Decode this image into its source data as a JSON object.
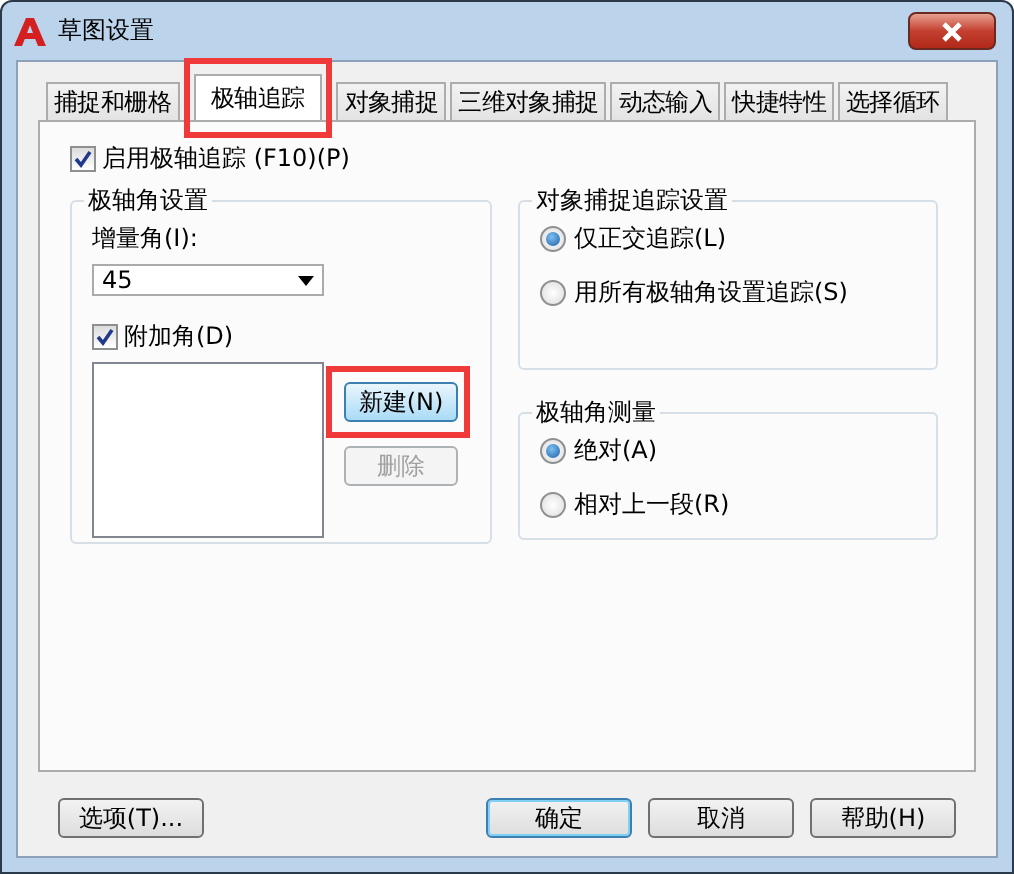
{
  "window": {
    "title": "草图设置"
  },
  "tabs": [
    {
      "label": "捕捉和栅格",
      "selected": false,
      "highlighted": false
    },
    {
      "label": "极轴追踪",
      "selected": true,
      "highlighted": true
    },
    {
      "label": "对象捕捉",
      "selected": false,
      "highlighted": false
    },
    {
      "label": "三维对象捕捉",
      "selected": false,
      "highlighted": false
    },
    {
      "label": "动态输入",
      "selected": false,
      "highlighted": false
    },
    {
      "label": "快捷特性",
      "selected": false,
      "highlighted": false
    },
    {
      "label": "选择循环",
      "selected": false,
      "highlighted": false
    }
  ],
  "enable_tracking": {
    "label": "启用极轴追踪 (F10)(P)",
    "checked": true
  },
  "polar_angle_settings": {
    "title": "极轴角设置",
    "increment_label": "增量角(I):",
    "increment_value": "45",
    "additional": {
      "label": "附加角(D)",
      "checked": true
    },
    "buttons": [
      {
        "label": "新建(N)",
        "disabled": false,
        "highlighted": true
      },
      {
        "label": "删除",
        "disabled": true,
        "highlighted": false
      }
    ]
  },
  "object_snap_tracking": {
    "title": "对象捕捉追踪设置",
    "options": [
      {
        "label": "仅正交追踪(L)",
        "selected": true
      },
      {
        "label": "用所有极轴角设置追踪(S)",
        "selected": false
      }
    ]
  },
  "polar_angle_measurement": {
    "title": "极轴角测量",
    "options": [
      {
        "label": "绝对(A)",
        "selected": true
      },
      {
        "label": "相对上一段(R)",
        "selected": false
      }
    ]
  },
  "footer_buttons": [
    {
      "label": "选项(T)...",
      "kind": "options"
    },
    {
      "label": "确定",
      "kind": "default"
    },
    {
      "label": "取消",
      "kind": "normal"
    },
    {
      "label": "帮助(H)",
      "kind": "normal"
    }
  ]
}
